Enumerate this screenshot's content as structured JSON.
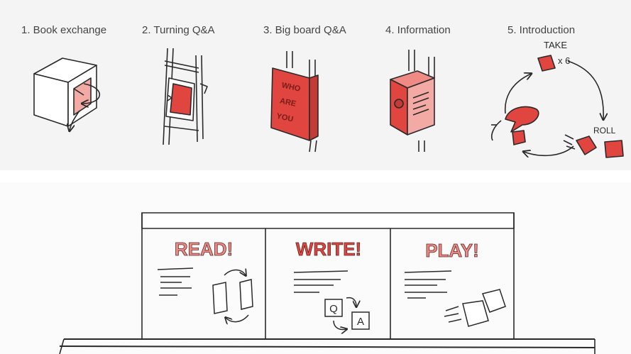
{
  "steps": [
    {
      "label": "1. Book exchange"
    },
    {
      "label": "2. Turning Q&A"
    },
    {
      "label": "3. Big board Q&A"
    },
    {
      "label": "4. Information"
    },
    {
      "label": "5. Introduction"
    }
  ],
  "intro_cycle": {
    "take_label": "TAKE",
    "count_label": "x 6",
    "roll_label": "ROLL"
  },
  "board_text": [
    "WHO",
    "ARE",
    "YOU"
  ],
  "panels": [
    {
      "title": "READ!"
    },
    {
      "title": "WRITE!"
    },
    {
      "title": "PLAY!"
    }
  ],
  "write_cards": {
    "q": "Q",
    "a": "A"
  },
  "colors": {
    "accent_red": "#e0453f",
    "accent_red_light": "#f3a9a4",
    "title_pink": "#ef8b84",
    "ink": "#2a2a2a",
    "top_bg": "#f4f4f4"
  }
}
